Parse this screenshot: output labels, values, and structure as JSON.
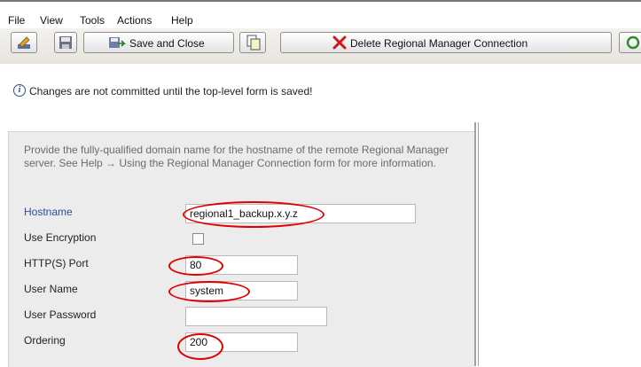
{
  "menu": {
    "file": "File",
    "view": "View",
    "tools": "Tools",
    "actions": "Actions",
    "help": "Help"
  },
  "toolbar": {
    "save_close": "Save and Close",
    "delete": "Delete Regional Manager Connection"
  },
  "notice": {
    "text": "Changes are not committed until the top-level form is saved!"
  },
  "form": {
    "help_text": "Provide the fully-qualified domain name for the hostname of the remote Regional Manager server. See Help → Using the Regional Manager Connection form for more information.",
    "hostname_label": "Hostname",
    "hostname_value": "regional1_backup.x.y.z",
    "encryption_label": "Use Encryption",
    "port_label": "HTTP(S) Port",
    "port_value": "80",
    "username_label": "User Name",
    "username_value": "system",
    "password_label": "User Password",
    "password_value": "",
    "ordering_label": "Ordering",
    "ordering_value": "200"
  }
}
